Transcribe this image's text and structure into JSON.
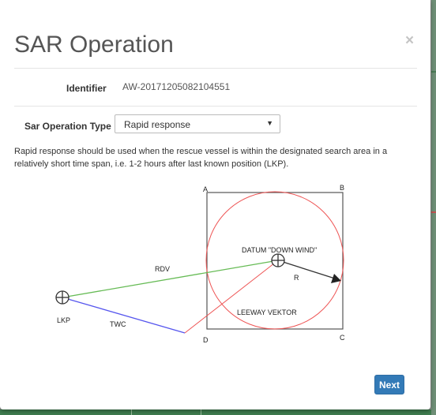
{
  "modal": {
    "title": "SAR Operation",
    "close_symbol": "×"
  },
  "identifier": {
    "label": "Identifier",
    "value": "AW-20171205082104551"
  },
  "sar_type": {
    "label": "Sar Operation Type",
    "selected": "Rapid response",
    "arrow": "▼"
  },
  "description": "Rapid response should be used when the rescue vessel is within the designated search area in a relatively short time span, i.e. 1-2 hours after last known position (LKP).",
  "diagram": {
    "corner_a": "A",
    "corner_b": "B",
    "corner_c": "C",
    "corner_d": "D",
    "datum": "DATUM \"DOWN WIND\"",
    "radius": "R",
    "rdv": "RDV",
    "lkp": "LKP",
    "twc": "TWC",
    "leeway": "LEEWAY VEKTOR",
    "colors": {
      "box": "#555555",
      "circle": "#ee5555",
      "rdv_line": "#66bb55",
      "twc_line": "#5555ee",
      "leeway_line": "#ee5555"
    }
  },
  "footer": {
    "next_label": "Next"
  }
}
